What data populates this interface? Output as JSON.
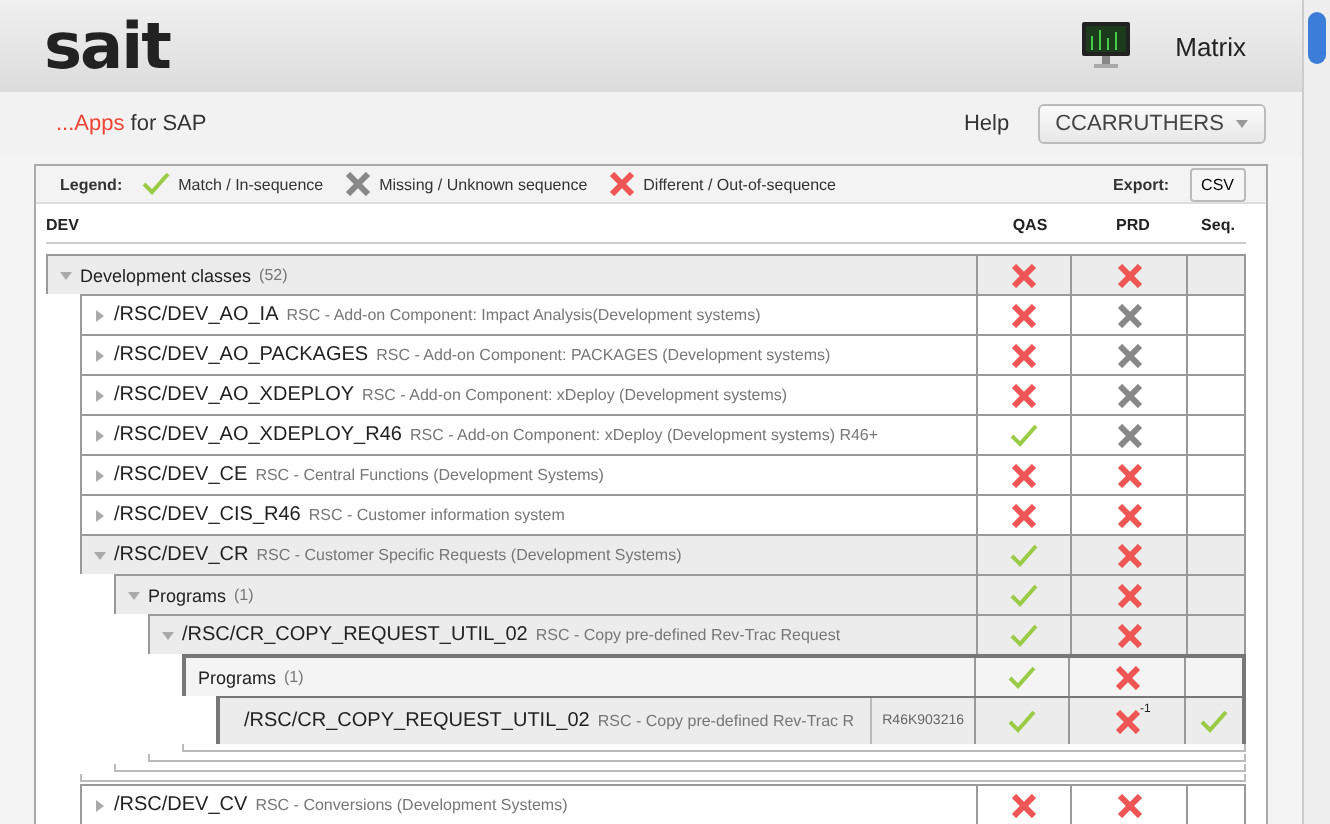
{
  "header": {
    "logo": "sait",
    "app_name": "Matrix",
    "tagline_accent": "...Apps",
    "tagline_rest": "for SAP",
    "help": "Help",
    "user": "CCARRUTHERS"
  },
  "legend": {
    "label": "Legend:",
    "items": [
      {
        "kind": "match",
        "text": "Match / In-sequence"
      },
      {
        "kind": "missing",
        "text": "Missing / Unknown sequence"
      },
      {
        "kind": "different",
        "text": "Different / Out-of-sequence"
      }
    ],
    "export_label": "Export:",
    "export_button": "CSV"
  },
  "table": {
    "columns": [
      "DEV",
      "QAS",
      "PRD",
      "Seq."
    ],
    "rows": [
      {
        "kind": "group",
        "expanded": true,
        "name": "Development classes",
        "count": "(52)",
        "qas": {
          "kind": "different"
        },
        "prd": {
          "kind": "different"
        },
        "children": [
          {
            "kind": "group",
            "expanded": false,
            "name": "/RSC/DEV_AO_IA",
            "description": "RSC - Add-on Component: Impact Analysis(Development systems)",
            "qas": {
              "kind": "different"
            },
            "prd": {
              "kind": "missing"
            }
          },
          {
            "kind": "group",
            "expanded": false,
            "name": "/RSC/DEV_AO_PACKAGES",
            "description": "RSC - Add-on Component: PACKAGES (Development systems)",
            "qas": {
              "kind": "different"
            },
            "prd": {
              "kind": "missing"
            }
          },
          {
            "kind": "group",
            "expanded": false,
            "name": "/RSC/DEV_AO_XDEPLOY",
            "description": "RSC - Add-on Component: xDeploy (Development systems)",
            "qas": {
              "kind": "different"
            },
            "prd": {
              "kind": "missing"
            }
          },
          {
            "kind": "group",
            "expanded": false,
            "name": "/RSC/DEV_AO_XDEPLOY_R46",
            "description": "RSC - Add-on Component: xDeploy (Development systems) R46+",
            "qas": {
              "kind": "match"
            },
            "prd": {
              "kind": "missing"
            }
          },
          {
            "kind": "group",
            "expanded": false,
            "name": "/RSC/DEV_CE",
            "description": "RSC - Central Functions (Development Systems)",
            "qas": {
              "kind": "different"
            },
            "prd": {
              "kind": "different"
            }
          },
          {
            "kind": "group",
            "expanded": false,
            "name": "/RSC/DEV_CIS_R46",
            "description": "RSC - Customer information system",
            "qas": {
              "kind": "different"
            },
            "prd": {
              "kind": "different"
            }
          },
          {
            "kind": "group",
            "expanded": true,
            "name": "/RSC/DEV_CR",
            "description": "RSC - Customer Specific Requests (Development Systems)",
            "qas": {
              "kind": "match"
            },
            "prd": {
              "kind": "different"
            },
            "children": [
              {
                "kind": "group",
                "expanded": true,
                "name": "Programs",
                "count": "(1)",
                "qas": {
                  "kind": "match"
                },
                "prd": {
                  "kind": "different"
                },
                "children": [
                  {
                    "kind": "group",
                    "expanded": true,
                    "name": "/RSC/CR_COPY_REQUEST_UTIL_02",
                    "description": "RSC - Copy pre-defined Rev-Trac Request",
                    "qas": {
                      "kind": "match"
                    },
                    "prd": {
                      "kind": "different"
                    },
                    "children": [
                      {
                        "kind": "header",
                        "name": "Programs",
                        "count": "(1)",
                        "qas": {
                          "kind": "match"
                        },
                        "prd": {
                          "kind": "different"
                        },
                        "children": [
                          {
                            "kind": "leaf",
                            "name": "/RSC/CR_COPY_REQUEST_UTIL_02",
                            "description": "RSC - Copy pre-defined Rev-Trac R",
                            "transport": "R46K903216",
                            "qas": {
                              "kind": "match"
                            },
                            "prd": {
                              "kind": "different",
                              "note": "-1"
                            },
                            "seq": {
                              "kind": "match"
                            }
                          }
                        ]
                      }
                    ]
                  }
                ]
              }
            ]
          },
          {
            "kind": "group",
            "expanded": false,
            "name": "/RSC/DEV_CV",
            "description": "RSC - Conversions (Development Systems)",
            "qas": {
              "kind": "different"
            },
            "prd": {
              "kind": "different"
            }
          }
        ]
      }
    ]
  }
}
